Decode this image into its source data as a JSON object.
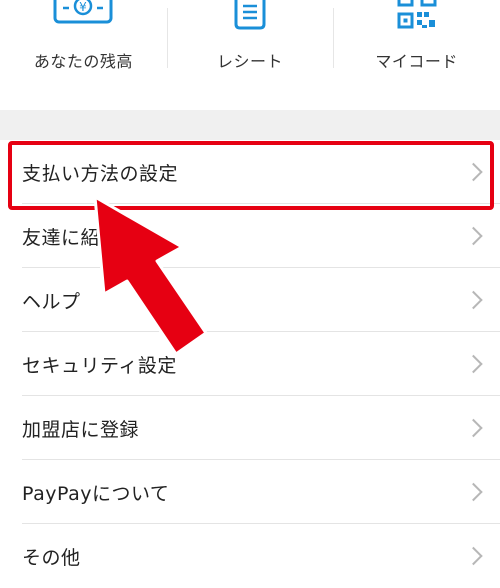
{
  "shortcuts": [
    {
      "label": "あなたの残高",
      "icon": "yen-card-icon"
    },
    {
      "label": "レシート",
      "icon": "receipt-icon"
    },
    {
      "label": "マイコード",
      "icon": "qr-code-icon"
    }
  ],
  "menu": {
    "items": [
      {
        "label": "支払い方法の設定"
      },
      {
        "label": "友達に紹介"
      },
      {
        "label": "ヘルプ"
      },
      {
        "label": "セキュリティ設定"
      },
      {
        "label": "加盟店に登録"
      },
      {
        "label": "PayPayについて"
      },
      {
        "label": "その他"
      }
    ]
  },
  "colors": {
    "accent_blue": "#1a8fd8",
    "highlight_red": "#e60012",
    "chevron_gray": "#b7b7b7"
  }
}
